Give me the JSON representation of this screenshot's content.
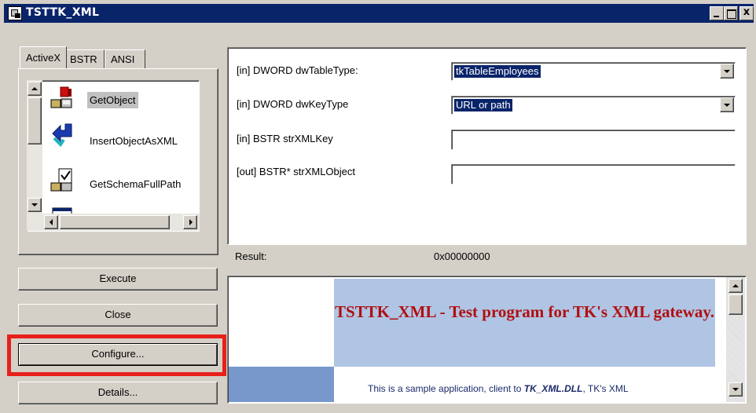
{
  "window": {
    "title": "TSTTK_XML",
    "controls": {
      "minimize": "_",
      "maximize": "",
      "close": "x"
    }
  },
  "tabs": [
    {
      "label": "ActiveX",
      "active": true
    },
    {
      "label": "BSTR",
      "active": false
    },
    {
      "label": "ANSI",
      "active": false
    }
  ],
  "objects": [
    {
      "label": "GetObject",
      "icon": "getobject-icon",
      "selected": true
    },
    {
      "label": "InsertObjectAsXML",
      "icon": "insert-arrow-icon",
      "selected": false
    },
    {
      "label": "GetSchemaFullPath",
      "icon": "schema-check-icon",
      "selected": false
    },
    {
      "label": "",
      "icon": "form-icon",
      "selected": false
    }
  ],
  "buttons": {
    "execute": "Execute",
    "close": "Close",
    "configure": "Configure...",
    "details": "Details..."
  },
  "params": [
    {
      "label": "[in] DWORD dwTableType:",
      "kind": "combo",
      "value": "tkTableEmployees"
    },
    {
      "label": "[in] DWORD dwKeyType",
      "kind": "combo",
      "value": "URL or path"
    },
    {
      "label": "[in] BSTR strXMLKey",
      "kind": "text",
      "value": ""
    },
    {
      "label": "[out] BSTR* strXMLObject",
      "kind": "text",
      "value": ""
    }
  ],
  "result": {
    "label": "Result:",
    "value": "0x00000000"
  },
  "browser": {
    "title": "TSTTK_XML - Test program for TK's XML gateway.",
    "body_prefix": "This is a sample application, client to ",
    "body_dll": "TK_XML.DLL",
    "body_suffix": ", TK's XML"
  },
  "colors": {
    "titlebar": "#0a246a",
    "face": "#d4d0c8",
    "highlight_box": "#e8201a",
    "browser_header": "#b0c4e4",
    "browser_title": "#b01010"
  }
}
